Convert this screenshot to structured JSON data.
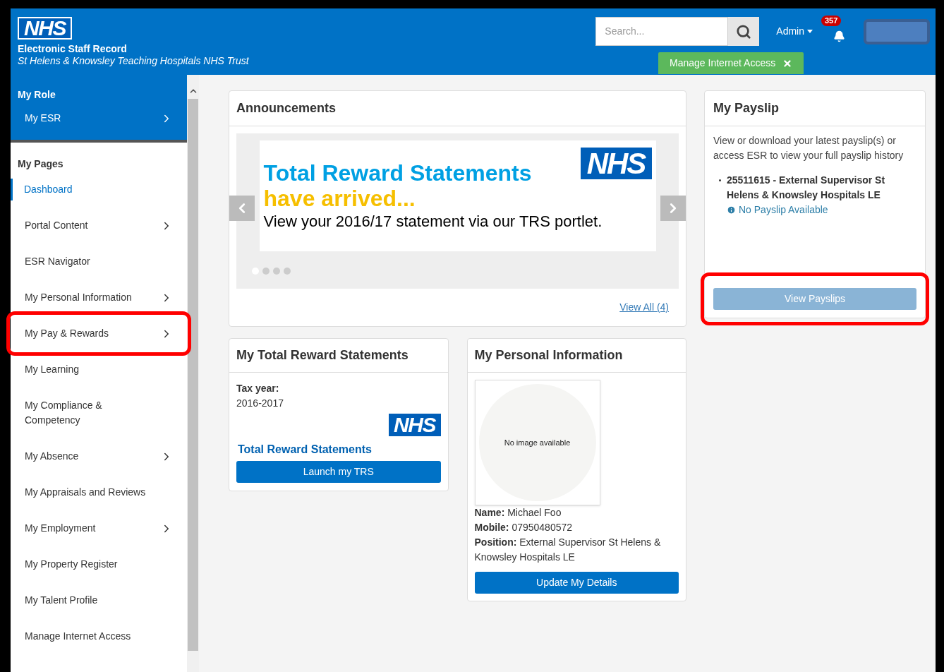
{
  "header": {
    "logo": "NHS",
    "title": "Electronic Staff Record",
    "organisation": "St Helens & Knowsley Teaching Hospitals NHS Trust",
    "search": {
      "placeholder": "Search..."
    },
    "admin_menu": "Admin",
    "notification_count": "357",
    "manage_button": "Manage Internet Access"
  },
  "sidebar": {
    "role_heading": "My Role",
    "role_item": {
      "label": "My ESR",
      "has_children": true
    },
    "pages_heading": "My Pages",
    "items": [
      {
        "label": "Dashboard",
        "selected": true,
        "has_children": false,
        "highlighted": false
      },
      {
        "label": "Portal Content",
        "selected": false,
        "has_children": true,
        "highlighted": false
      },
      {
        "label": "ESR Navigator",
        "selected": false,
        "has_children": false,
        "highlighted": false
      },
      {
        "label": "My Personal Information",
        "selected": false,
        "has_children": true,
        "highlighted": false
      },
      {
        "label": "My Pay & Rewards",
        "selected": false,
        "has_children": true,
        "highlighted": true
      },
      {
        "label": "My Learning",
        "selected": false,
        "has_children": false,
        "highlighted": false
      },
      {
        "label": "My Compliance & Competency",
        "selected": false,
        "has_children": false,
        "highlighted": false
      },
      {
        "label": "My Absence",
        "selected": false,
        "has_children": true,
        "highlighted": false
      },
      {
        "label": "My Appraisals and Reviews",
        "selected": false,
        "has_children": false,
        "highlighted": false
      },
      {
        "label": "My Employment",
        "selected": false,
        "has_children": true,
        "highlighted": false
      },
      {
        "label": "My Property Register",
        "selected": false,
        "has_children": false,
        "highlighted": false
      },
      {
        "label": "My Talent Profile",
        "selected": false,
        "has_children": false,
        "highlighted": false
      },
      {
        "label": "Manage Internet Access",
        "selected": false,
        "has_children": false,
        "highlighted": false
      }
    ]
  },
  "announcements": {
    "title": "Announcements",
    "banner": {
      "headline": "Total Reward Statements",
      "subline": "have arrived...",
      "body": "View your 2016/17 statement via our TRS portlet.",
      "logo": "NHS"
    },
    "dots": [
      {
        "selected": true
      },
      {
        "selected": false
      },
      {
        "selected": false
      },
      {
        "selected": false
      }
    ],
    "link": "View All (4)"
  },
  "payslip": {
    "title": "My Payslip",
    "description": "View or download your latest payslip(s) or access ESR to view your full payslip history",
    "assignments": [
      {
        "label": "25511615 - External Supervisor St Helens & Knowsley Hospitals LE",
        "status": "No Payslip Available"
      }
    ],
    "button": {
      "label": "View Payslips",
      "disabled": true,
      "highlighted": true
    }
  },
  "reward_statements": {
    "title": "My Total Reward Statements",
    "tax_year_label": "Tax year:",
    "tax_year": "2016-2017",
    "logo": "NHS",
    "brand": "Total Reward Statements",
    "button": "Launch my TRS"
  },
  "personal_information": {
    "title": "My Personal Information",
    "photo_caption": "No image available",
    "fields": [
      {
        "label": "Name:",
        "value": "Michael Foo"
      },
      {
        "label": "Mobile:",
        "value": "07950480572"
      },
      {
        "label": "Position:",
        "value": "External Supervisor St Helens & Knowsley Hospitals LE"
      }
    ],
    "button": "Update My Details"
  }
}
